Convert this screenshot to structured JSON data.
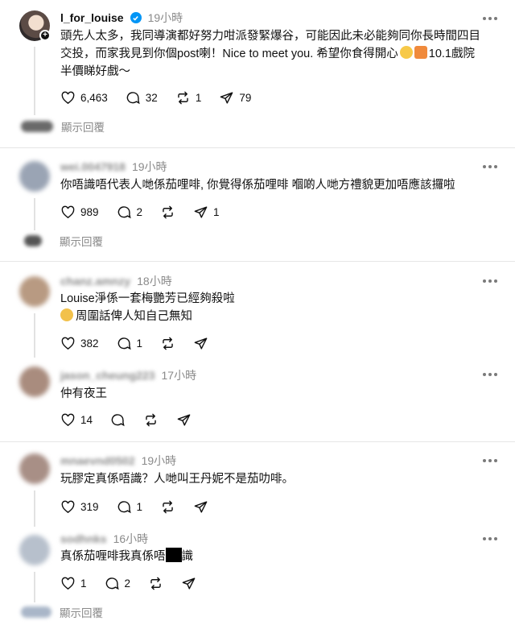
{
  "posts": [
    {
      "username": "l_for_louise",
      "time": "19小時",
      "text_line1": "頭先人太多，我同導演都好努力咁派發緊爆谷，可能因此未必能夠同你長時間四目",
      "text_line2": "交投，而家我見到你個post喇！Nice to meet you. 希望你食得開心",
      "text_line2_after": "10.1戲院",
      "text_line3": "半價睇好戲～",
      "likes": "6,463",
      "comments": "32",
      "reposts": "1",
      "shares": "79",
      "show_replies": "顯示回覆"
    },
    {
      "username": "wei.0047918",
      "time": "19小時",
      "text": "你唔識唔代表人哋係茄哩啡, 你覺得係茄哩啡 嗰啲人哋方禮貌更加唔應該攞啦",
      "likes": "989",
      "comments": "2",
      "shares": "1",
      "show_replies": "顯示回覆"
    },
    {
      "username": "chanz.amnzy",
      "time": "18小時",
      "text_line1": "Louise淨係一套梅艷芳已經夠殺啦",
      "text_line2": "周圍話俾人知自己無知",
      "likes": "382",
      "comments": "1"
    },
    {
      "username": "jason_cheung223",
      "time": "17小時",
      "text": "仲有夜王",
      "likes": "14"
    },
    {
      "username": "mnaevnd0502",
      "time": "19小時",
      "text": "玩膠定真係唔識？人哋叫王丹妮不是茄叻啡。",
      "likes": "319",
      "comments": "1"
    },
    {
      "username": "sodhnks",
      "time": "16小時",
      "text_before": "真係茄喱啡我真係唔",
      "text_after": "識",
      "likes": "1",
      "comments": "2",
      "show_replies": "顯示回覆"
    }
  ],
  "colors": {
    "verified": "#0095f6",
    "muted": "#8a8a8a",
    "divider": "#e6e6e6"
  }
}
